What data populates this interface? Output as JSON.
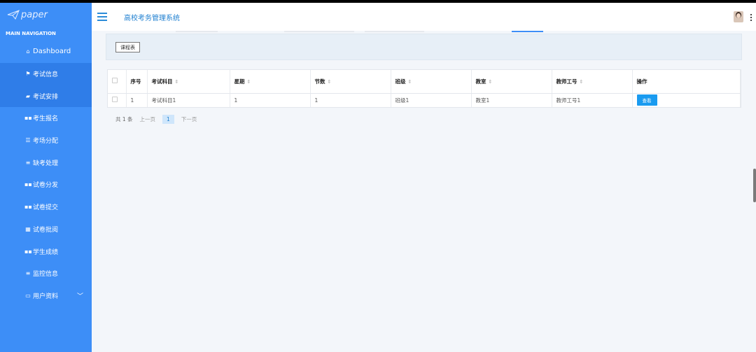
{
  "sidebar": {
    "logo_text": "paper",
    "heading": "MAIN NAVIGATION",
    "items": [
      {
        "label": "Dashboard",
        "icon": "home-icon"
      },
      {
        "label": "考试信息",
        "icon": "flag-icon"
      },
      {
        "label": "考试安排",
        "icon": "comment-icon"
      },
      {
        "label": "考生报名",
        "icon": "grid-icon"
      },
      {
        "label": "考场分配",
        "icon": "sliders-icon"
      },
      {
        "label": "缺考处理",
        "icon": "list-icon"
      },
      {
        "label": "试卷分发",
        "icon": "grid-icon"
      },
      {
        "label": "试卷提交",
        "icon": "grid-icon"
      },
      {
        "label": "试卷批阅",
        "icon": "table-icon"
      },
      {
        "label": "学生成绩",
        "icon": "grid-icon"
      },
      {
        "label": "监控信息",
        "icon": "list-icon"
      },
      {
        "label": "用户资料",
        "icon": "card-icon"
      }
    ]
  },
  "header": {
    "title": "高校考务管理系统"
  },
  "toolbar": {
    "button_label": "课程表"
  },
  "table": {
    "columns": [
      "序号",
      "考试科目",
      "星期",
      "节数",
      "班级",
      "教室",
      "教师工号",
      "操作"
    ],
    "rows": [
      {
        "index": "1",
        "subject": "考试科目1",
        "weekday": "1",
        "period": "1",
        "class": "班级1",
        "room": "教室1",
        "teacher_id": "教师工号1",
        "action": "查看"
      }
    ]
  },
  "pagination": {
    "total": "共 1 条",
    "prev": "上一页",
    "current": "1",
    "next": "下一页"
  },
  "colors": {
    "sidebar": "#3d8ef7",
    "accent": "#1a9bf0",
    "header_title": "#1e7fd0"
  }
}
